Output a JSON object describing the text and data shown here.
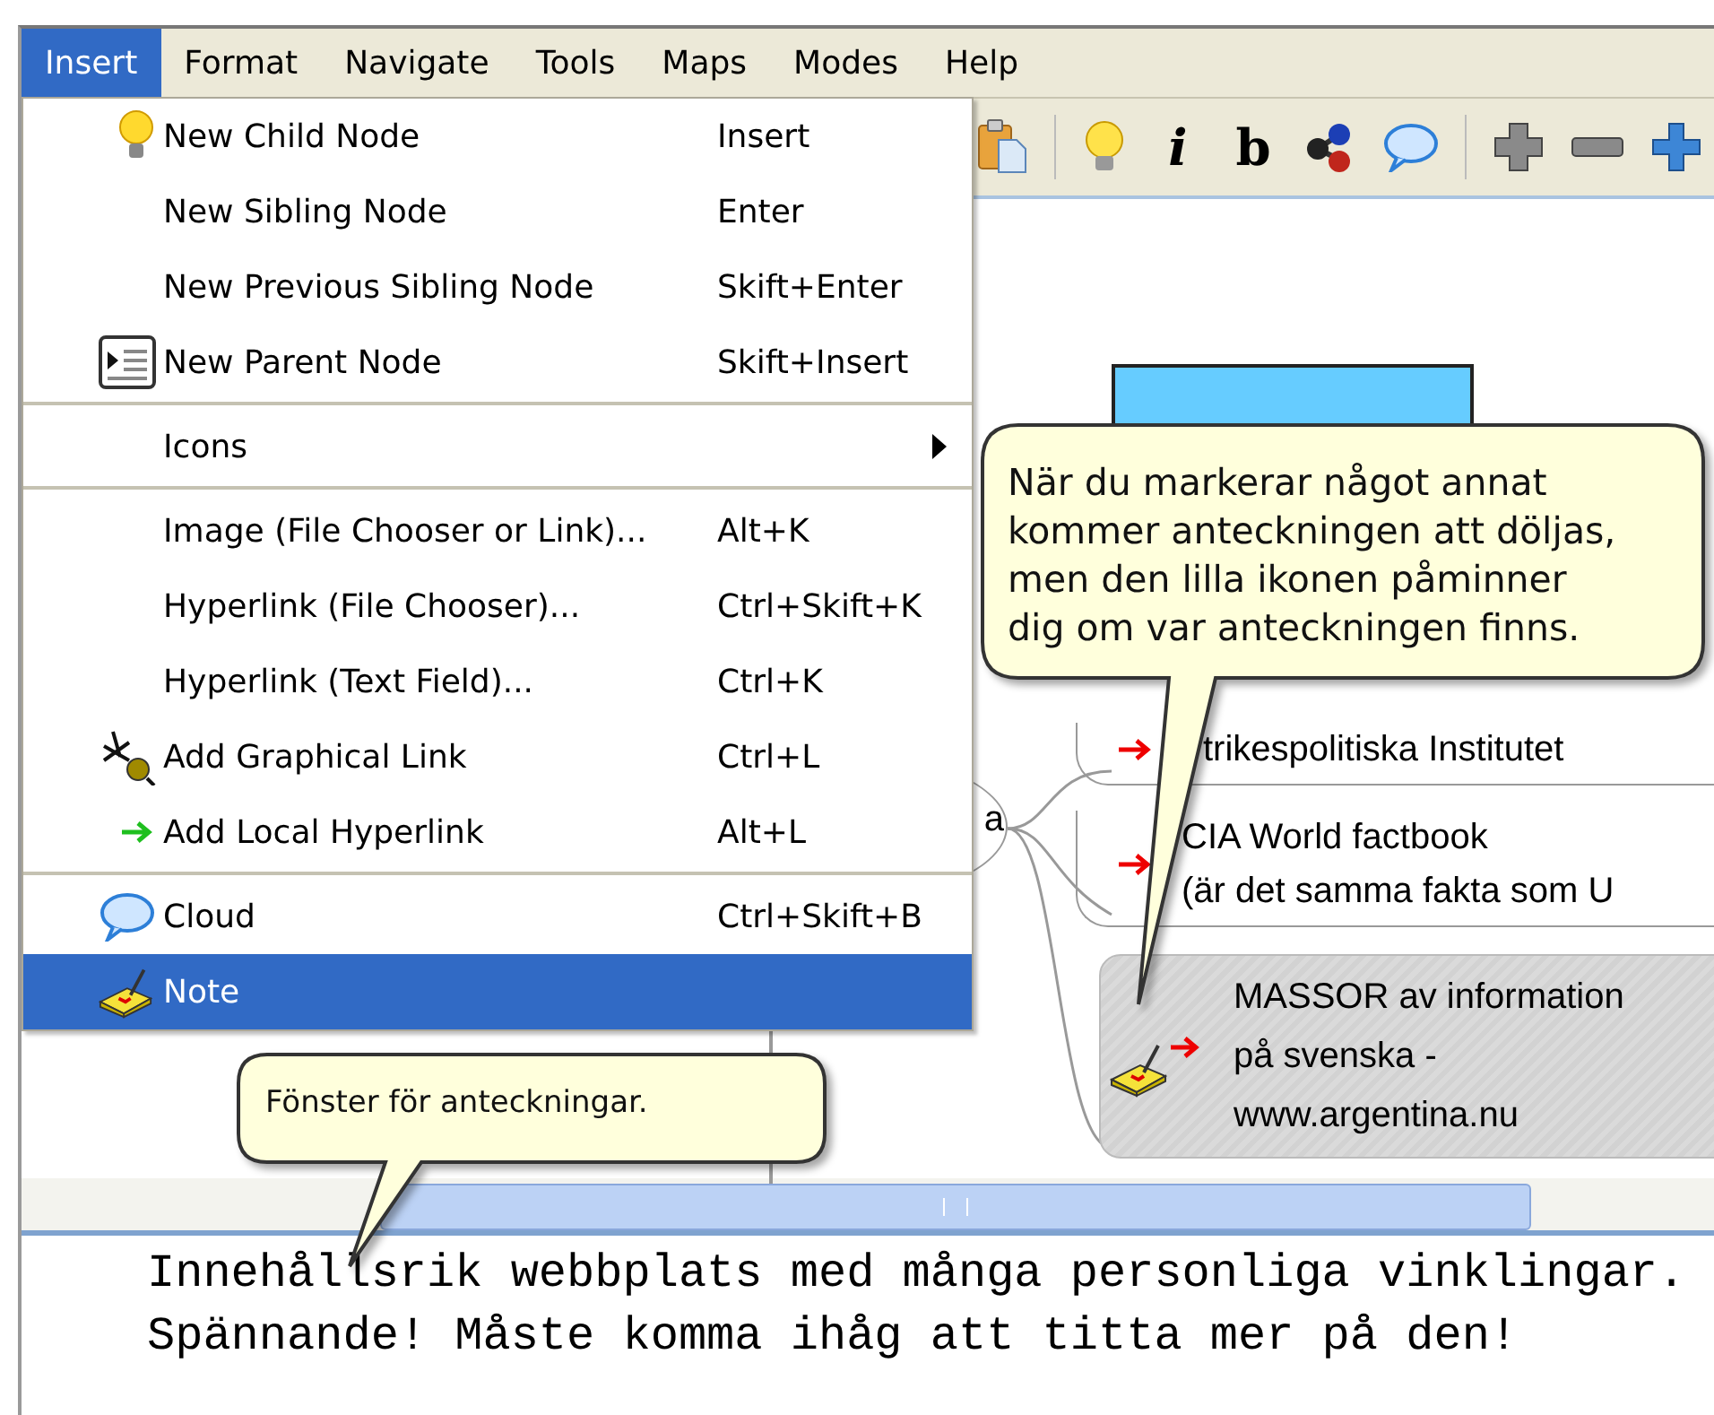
{
  "menubar": [
    {
      "label": "Insert",
      "selected": true
    },
    {
      "label": "Format",
      "selected": false
    },
    {
      "label": "Navigate",
      "selected": false
    },
    {
      "label": "Tools",
      "selected": false
    },
    {
      "label": "Maps",
      "selected": false
    },
    {
      "label": "Modes",
      "selected": false
    },
    {
      "label": "Help",
      "selected": false
    }
  ],
  "toolbar": {
    "italic": "i",
    "bold": "b"
  },
  "menu": {
    "items": [
      {
        "kind": "item",
        "label": "New Child Node",
        "shortcut": "Insert",
        "selected": false
      },
      {
        "kind": "item",
        "label": "New Sibling Node",
        "shortcut": "Enter",
        "selected": false
      },
      {
        "kind": "item",
        "label": "New Previous Sibling Node",
        "shortcut": "Skift+Enter",
        "selected": false
      },
      {
        "kind": "item",
        "label": "New Parent Node",
        "shortcut": "Skift+Insert",
        "selected": false
      },
      {
        "kind": "separator"
      },
      {
        "kind": "submenu",
        "label": "Icons",
        "selected": false
      },
      {
        "kind": "separator"
      },
      {
        "kind": "item",
        "label": "Image (File Chooser or Link)...",
        "shortcut": "Alt+K",
        "selected": false
      },
      {
        "kind": "item",
        "label": "Hyperlink (File Chooser)...",
        "shortcut": "Ctrl+Skift+K",
        "selected": false
      },
      {
        "kind": "item",
        "label": "Hyperlink (Text Field)...",
        "shortcut": "Ctrl+K",
        "selected": false
      },
      {
        "kind": "item",
        "label": "Add Graphical Link",
        "shortcut": "Ctrl+L",
        "selected": false
      },
      {
        "kind": "item",
        "label": "Add Local Hyperlink",
        "shortcut": "Alt+L",
        "selected": false
      },
      {
        "kind": "separator"
      },
      {
        "kind": "item",
        "label": "Cloud",
        "shortcut": "Ctrl+Skift+B",
        "selected": false
      },
      {
        "kind": "item",
        "label": "Note",
        "selected": true
      }
    ]
  },
  "map": {
    "nodes": [
      {
        "kind": "box"
      },
      {
        "kind": "root",
        "label": "a"
      },
      {
        "kind": "link",
        "lines": [
          "trikespolitiska Institutet"
        ]
      },
      {
        "kind": "link",
        "lines": [
          "CIA World factbook",
          "(är det samma fakta som U"
        ]
      },
      {
        "kind": "note",
        "selected": true,
        "lines": [
          "MASSOR av information",
          "på svenska -",
          "www.argentina.nu"
        ]
      }
    ]
  },
  "callouts": [
    {
      "text": "När du markerar något annat\nkommer anteckningen att döljas,\nmen den lilla ikonen påminner\ndig om var anteckningen finns."
    },
    {
      "text": "Fönster för anteckningar."
    }
  ],
  "note_pane": {
    "lines": [
      "Innehållsrik webbplats med många personliga vinklingar.",
      "Spännande! Måste komma ihåg att titta mer på den!"
    ]
  }
}
